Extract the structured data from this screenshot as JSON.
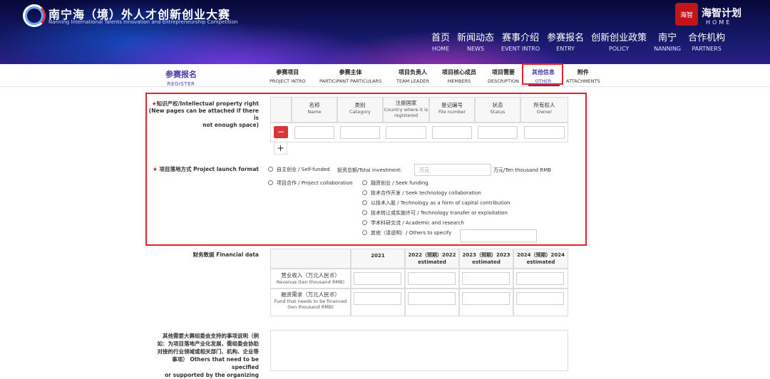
{
  "header": {
    "logo_cn": "南宁海（境）外人才创新创业大赛",
    "logo_en": "Nanning International Talents Innovation and Entrepreneurship Competition",
    "seal_text": "海智",
    "brand_cn": "海智计划",
    "brand_en": "HOME",
    "nav": [
      {
        "cn": "首页",
        "en": "HOME"
      },
      {
        "cn": "新闻动态",
        "en": "NEWS"
      },
      {
        "cn": "赛事介绍",
        "en": "EVENT INTRO"
      },
      {
        "cn": "参赛报名",
        "en": "ENTRY"
      },
      {
        "cn": "创新创业政策",
        "en": "POLICY"
      },
      {
        "cn": "南宁",
        "en": "NANNING"
      },
      {
        "cn": "合作机构",
        "en": "PARTNERS"
      }
    ]
  },
  "subnav": {
    "register_cn": "参赛报名",
    "register_en": "REGISTER",
    "tabs": [
      {
        "cn": "参赛项目",
        "en": "PROJECT INTRO"
      },
      {
        "cn": "参赛主体",
        "en": "PARTICIPANT PARTICULARS"
      },
      {
        "cn": "项目负责人",
        "en": "TEAM LEADER"
      },
      {
        "cn": "项目核心成员",
        "en": "MEMBERS"
      },
      {
        "cn": "项目需要",
        "en": "DESCRIPTION"
      },
      {
        "cn": "其他信息",
        "en": "OTHER"
      },
      {
        "cn": "附件",
        "en": "ATTACHMENTS"
      }
    ]
  },
  "ip": {
    "label_star": "★",
    "label_line1": "知识产权/Intellectual property right",
    "label_line2": "(New pages can be attached if there is",
    "label_line3": "not enough space)",
    "columns": [
      {
        "cn": "名称",
        "en": "Name"
      },
      {
        "cn": "类别",
        "en": "Category"
      },
      {
        "cn": "注册国家",
        "en": "Country where it is registered"
      },
      {
        "cn": "登记编号",
        "en": "File number"
      },
      {
        "cn": "状态",
        "en": "Status"
      },
      {
        "cn": "所有权人",
        "en": "Owner"
      }
    ],
    "minus": "−",
    "plus": "+"
  },
  "launch": {
    "label_star": "★",
    "label": "项目落地方式 Project launch format",
    "opt_self": "自主创业 / Self-funded",
    "investment_label": "投资总额/Total investment:",
    "investment_placeholder": "万元",
    "investment_unit": "万元/Ten thousand RMB",
    "opt_collab": "项目合作 / Project collaboration",
    "sub_options": [
      "融资创业 / Seek funding",
      "技术合作开发 / Seek technology collaboration",
      "以技术入股 / Technology as a form of capital contribution",
      "技术转让或实施许可 / Technology transfer or exploitation",
      "学术科研交流 / Academic and research",
      "其他（请说明）/ Others to specify"
    ]
  },
  "financial": {
    "label": "财务数据 Financial data",
    "years": [
      {
        "a": "2021",
        "b": ""
      },
      {
        "a": "2022（预期）2022",
        "b": "estimated"
      },
      {
        "a": "2023（预期）2023",
        "b": "estimated"
      },
      {
        "a": "2024（预期）2024",
        "b": "estimated"
      }
    ],
    "rows": [
      {
        "cn": "营业收入（万元人民币）",
        "en1": "Revenue (ten thousand RMB)",
        "en2": ""
      },
      {
        "cn": "融资需求（万元人民币）",
        "en1": "Fund that needs to be financed",
        "en2": "(ten thousand RMB)"
      }
    ]
  },
  "other_support": {
    "lines": [
      "其他需要大赛组委会支持的事项说明（例",
      "如：为项目落地产业化发展，需组委会协助",
      "对接的行业领域或相关部门、机构、企业等",
      "事项） Others that need to be specified",
      "or supported by the organizing"
    ]
  }
}
